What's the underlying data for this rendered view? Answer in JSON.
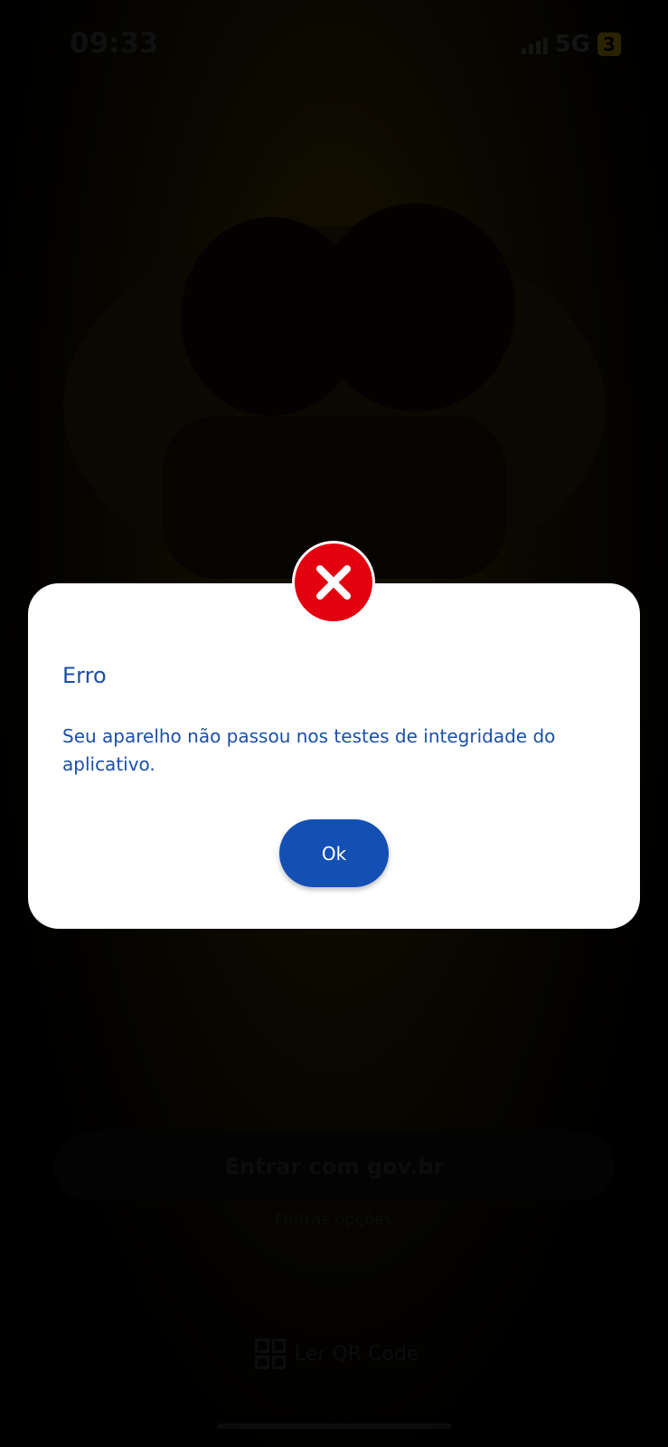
{
  "status_bar": {
    "time": "09:33",
    "network": "5G",
    "battery": "3"
  },
  "background_screen": {
    "primary_button_label": "Entrar com gov.br",
    "secondary_link": "Outras opções",
    "qr_label": "Ler QR Code"
  },
  "dialog": {
    "icon": "error-x-icon",
    "title": "Erro",
    "message": "Seu aparelho não passou nos testes de integridade do aplicativo.",
    "ok_label": "Ok"
  },
  "colors": {
    "dialog_text": "#1b4fa8",
    "ok_button": "#1450b3",
    "error_red": "#e3000f",
    "overlay": "#000000"
  }
}
